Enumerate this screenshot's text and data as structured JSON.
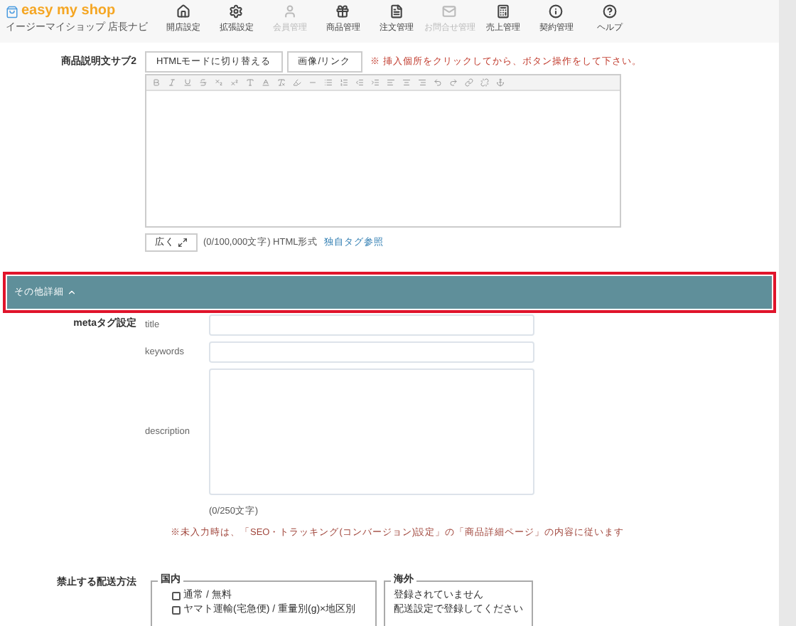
{
  "header": {
    "logo": "easy my shop",
    "subtitle": "イージーマイショップ 店長ナビ",
    "nav": [
      {
        "label": "開店設定",
        "disabled": false
      },
      {
        "label": "拡張設定",
        "disabled": false
      },
      {
        "label": "会員管理",
        "disabled": true
      },
      {
        "label": "商品管理",
        "disabled": false
      },
      {
        "label": "注文管理",
        "disabled": false
      },
      {
        "label": "お問合せ管理",
        "disabled": true
      },
      {
        "label": "売上管理",
        "disabled": false
      },
      {
        "label": "契約管理",
        "disabled": false
      },
      {
        "label": "ヘルプ",
        "disabled": false
      }
    ]
  },
  "editor": {
    "label": "商品説明文サブ2",
    "buttons": [
      "HTMLモードに切り替える",
      "画像/リンク"
    ],
    "hint": "※ 挿入個所をクリックしてから、ボタン操作をして下さい。",
    "expand_button": "広く",
    "count": "(0/100,000文字) HTML形式",
    "link": "独自タグ参照"
  },
  "section": {
    "title": "その他詳細",
    "expanded": true
  },
  "meta": {
    "label": "metaタグ設定",
    "fields": [
      {
        "label": "title",
        "kind": "input"
      },
      {
        "label": "keywords",
        "kind": "input"
      },
      {
        "label": "description",
        "kind": "textarea"
      }
    ],
    "count": "(0/250文字)",
    "note": "※未入力時は、「SEO・トラッキング(コンバージョン)設定」の「商品詳細ページ」の内容に従います"
  },
  "shipping": {
    "label": "禁止する配送方法",
    "domestic": {
      "legend": "国内",
      "options": [
        {
          "label": "通常 / 無料",
          "checked": false
        },
        {
          "label": "ヤマト運輸(宅急便) / 重量別(g)×地区別",
          "checked": false
        }
      ]
    },
    "overseas": {
      "legend": "海外",
      "lines": [
        "登録されていません",
        "配送設定で登録してください"
      ]
    }
  }
}
